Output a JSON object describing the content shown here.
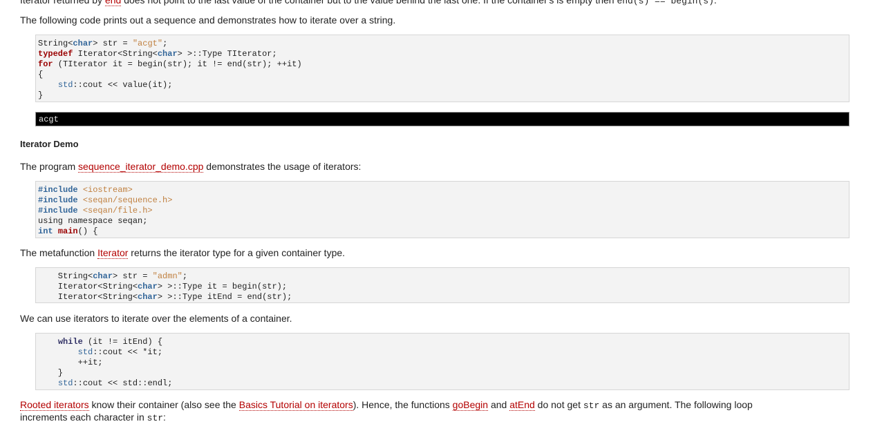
{
  "top_cut": {
    "prefix": "Iterator returned by ",
    "link": "end",
    "rest": " does not point to the last value of the container but to the value behind the last one. If the container's is empty then ",
    "code": "end(s) == begin(s)",
    "end": "."
  },
  "p1": "The following code prints out a sequence and demonstrates how to iterate over a string.",
  "code1": [
    "String<char> str = \"acgt\";",
    "typedef Iterator<String<char> >::Type TIterator;",
    "for (TIterator it = begin(str); it != end(str); ++it)",
    "{",
    "    std::cout << value(it);",
    "}"
  ],
  "output1": "acgt",
  "heading": "Iterator Demo",
  "p2": {
    "prefix": "The program ",
    "link": "sequence_iterator_demo.cpp",
    "suffix": " demonstrates the usage of iterators:"
  },
  "code2": [
    "#include <iostream>",
    "#include <seqan/sequence.h>",
    "#include <seqan/file.h>",
    "using namespace seqan;",
    "int main() {"
  ],
  "p3": {
    "prefix": "The metafunction ",
    "link": "Iterator",
    "suffix": " returns the iterator type for a given container type."
  },
  "code3": [
    "    String<char> str = \"admn\";",
    "    Iterator<String<char> >::Type it = begin(str);",
    "    Iterator<String<char> >::Type itEnd = end(str);"
  ],
  "p4": "We can use iterators to iterate over the elements of a container.",
  "code4": [
    "    while (it != itEnd) {",
    "        std::cout << *it;",
    "        ++it;",
    "    }",
    "    std::cout << std::endl;"
  ],
  "p5": {
    "link1": "Rooted iterators",
    "t1": " know their container (also see the ",
    "link2": "Basics Tutorial on iterators",
    "t2": "). Hence, the functions ",
    "link3": "goBegin",
    "t3": " and ",
    "link4": "atEnd",
    "t4": " do not get ",
    "code": "str",
    "t5": " as an argument. The following loop",
    "line2": "increments each character in ",
    "code2": "str",
    "end": ":"
  }
}
